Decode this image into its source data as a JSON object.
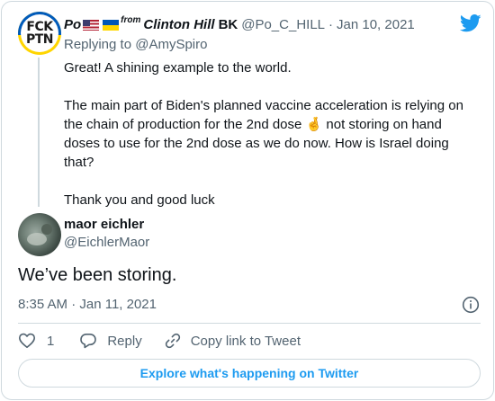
{
  "parent_tweet": {
    "avatar_text": [
      "FCK",
      "PTN"
    ],
    "display_name_prefix": "Po",
    "from_label": "from",
    "display_name_main": "Clinton Hill",
    "display_name_tail": "BK",
    "handle": "@Po_C_HILL",
    "separator": "·",
    "date": "Jan 10, 2021",
    "replying_to_label": "Replying to",
    "replying_to_handle": "@AmySpiro",
    "paragraphs": {
      "p1": "Great! A shining example to the world.",
      "p2_before_emoji": "The main part of Biden's planned vaccine acceleration is relying on the chain of production for the 2nd dose",
      "p2_emoji": "🤞",
      "p2_after_emoji": " not storing on hand doses to use for the 2nd dose as we do now. How is Israel doing that?",
      "p3": "Thank you and good luck"
    },
    "flag_icons": [
      "us-flag-icon",
      "ukraine-flag-icon"
    ]
  },
  "main_tweet": {
    "display_name": "maor eichler",
    "handle": "@EichlerMaor",
    "text": "We’ve been storing.",
    "timestamp": "8:35 AM · Jan 11, 2021"
  },
  "actions": {
    "like_count": "1",
    "reply_label": "Reply",
    "copy_link_label": "Copy link to Tweet"
  },
  "explore_label": "Explore what's happening on Twitter",
  "icons": {
    "brand": "twitter-bird-icon",
    "info": "info-icon",
    "like": "heart-icon",
    "reply": "speech-bubble-icon",
    "copy": "link-icon"
  },
  "colors": {
    "brand": "#1d9bf0",
    "text_primary": "#0f1419",
    "text_secondary": "#536471",
    "border": "#cfd9de"
  }
}
